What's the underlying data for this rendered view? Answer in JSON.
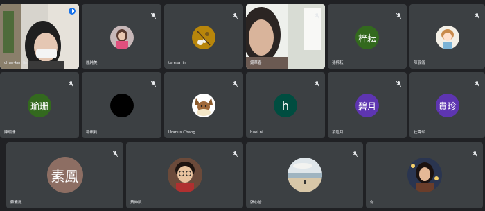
{
  "participants": [
    {
      "id": "p1",
      "name": "chun-ken lin",
      "kind": "video",
      "active": true
    },
    {
      "id": "p2",
      "name": "麗純美",
      "kind": "photo",
      "avatar_icon": "woman-photo-avatar"
    },
    {
      "id": "p3",
      "name": "teresa lin",
      "kind": "photo",
      "avatar_icon": "flower-photo-avatar"
    },
    {
      "id": "p4",
      "name": "錢華春",
      "kind": "video"
    },
    {
      "id": "p5",
      "name": "孫梓耘",
      "kind": "letter",
      "initials": "梓耘",
      "color": "#33691e"
    },
    {
      "id": "p6",
      "name": "陳靜儀",
      "kind": "photo",
      "avatar_icon": "cartoon-girl-avatar"
    },
    {
      "id": "p7",
      "name": "陳瑜珊",
      "kind": "letter",
      "initials": "瑜珊",
      "color": "#33691e"
    },
    {
      "id": "p8",
      "name": "楊珮莉",
      "kind": "photo",
      "avatar_icon": "black-avatar"
    },
    {
      "id": "p9",
      "name": "Uranus Chang",
      "kind": "photo",
      "avatar_icon": "eevee-avatar"
    },
    {
      "id": "p10",
      "name": "huei ni",
      "kind": "letter",
      "initials": "h",
      "color": "#004d40"
    },
    {
      "id": "p11",
      "name": "凌碧月",
      "kind": "letter",
      "initials": "碧月",
      "color": "#5e35b1"
    },
    {
      "id": "p12",
      "name": "莊貴珍",
      "kind": "letter",
      "initials": "貴珍",
      "color": "#5e35b1"
    },
    {
      "id": "p13",
      "name": "蘇素鳳",
      "kind": "letter",
      "initials": "素鳳",
      "color": "#8d6e63"
    },
    {
      "id": "p14",
      "name": "黃伸凱",
      "kind": "photo",
      "avatar_icon": "boy-glasses-avatar"
    },
    {
      "id": "p15",
      "name": "張心怡",
      "kind": "photo",
      "avatar_icon": "beach-photo-avatar"
    },
    {
      "id": "p16",
      "name": "你",
      "kind": "photo",
      "avatar_icon": "girl-photo-avatar"
    }
  ],
  "colors": {
    "background": "#202124",
    "tile": "#3c4043",
    "active_border": "#8ab4f8",
    "speaking_badge": "#1a73e8"
  }
}
